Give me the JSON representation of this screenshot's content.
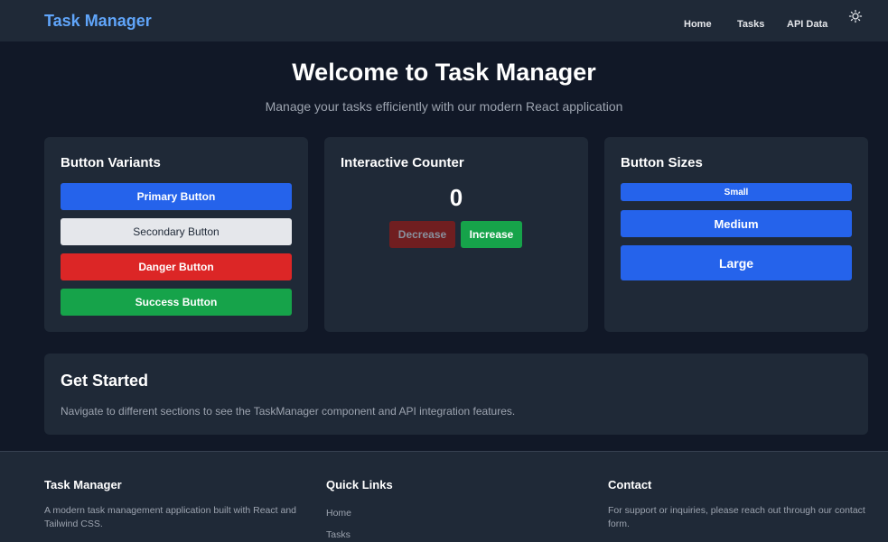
{
  "navbar": {
    "brand": "Task Manager",
    "links": [
      "Home",
      "Tasks",
      "API Data"
    ],
    "theme_icon": "sun-icon"
  },
  "hero": {
    "title": "Welcome to Task Manager",
    "subtitle": "Manage your tasks efficiently with our modern React application"
  },
  "button_variants": {
    "title": "Button Variants",
    "primary": "Primary Button",
    "secondary": "Secondary Button",
    "danger": "Danger Button",
    "success": "Success Button"
  },
  "counter": {
    "title": "Interactive Counter",
    "value": "0",
    "decrease": "Decrease",
    "increase": "Increase"
  },
  "button_sizes": {
    "title": "Button Sizes",
    "small": "Small",
    "medium": "Medium",
    "large": "Large"
  },
  "get_started": {
    "title": "Get Started",
    "text": "Navigate to different sections to see the TaskManager component and API integration features."
  },
  "footer": {
    "about": {
      "heading": "Task Manager",
      "text_line1": "A modern task management application built with React and",
      "text_line2": "Tailwind CSS."
    },
    "quick_links": {
      "heading": "Quick Links",
      "links": [
        "Home",
        "Tasks"
      ]
    },
    "contact": {
      "heading": "Contact",
      "text_line1": "For support or inquiries, please reach out through our contact",
      "text_line2": "form."
    }
  },
  "colors": {
    "background": "#111827",
    "surface": "#1f2937",
    "brand": "#60a5fa",
    "primary": "#2563eb",
    "danger": "#dc2626",
    "success": "#16a34a"
  }
}
